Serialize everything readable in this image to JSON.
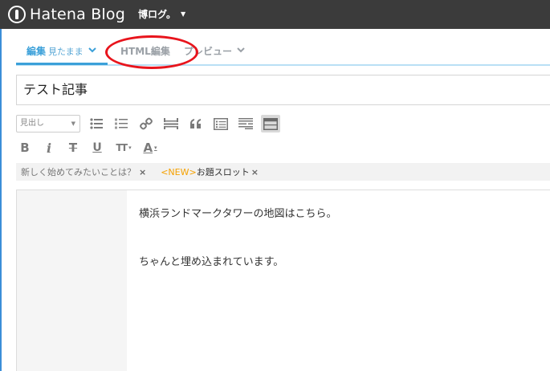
{
  "header": {
    "logo_text": "Hatena Blog",
    "blog_name": "博ログ。",
    "blog_caret": "▼"
  },
  "tabs": [
    {
      "label": "編集",
      "sub": "見たまま",
      "active": true
    },
    {
      "label": "HTML編集",
      "active": false
    },
    {
      "label": "プレビュー",
      "active": false
    }
  ],
  "tab_chevron": "⌄",
  "title_value": "テスト記事",
  "toolbar": {
    "heading_select_value": "見出し",
    "heading_caret": "▼",
    "row1_icons": [
      "bulleted-list-icon",
      "numbered-list-icon",
      "link-icon",
      "horizontal-rule-icon",
      "quote-icon",
      "table-of-contents-icon",
      "read-more-icon",
      "table-icon"
    ],
    "row2": {
      "bold": "B",
      "italic": "i",
      "strike": "T",
      "underline": "U",
      "font_size": "TT",
      "font_color": "A"
    }
  },
  "tagbar": {
    "suggestion": "新しく始めてみたいことは？",
    "new_badge": "<NEW>",
    "topic": "お題スロット",
    "close": "×"
  },
  "editor": {
    "paragraphs": [
      "横浜ランドマークタワーの地図はこちら。",
      "ちゃんと埋め込まれています。"
    ]
  },
  "colors": {
    "topbar": "#3b3b3b",
    "accent": "#3ba0d9",
    "highlight": "#e8141c",
    "new_badge": "#f5a100"
  }
}
